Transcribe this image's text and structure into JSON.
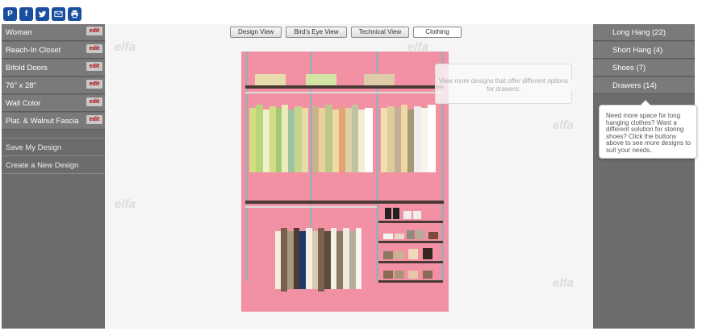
{
  "share": {
    "icons": [
      "pinterest-icon",
      "facebook-icon",
      "twitter-icon",
      "email-icon",
      "print-icon"
    ],
    "labels": [
      "P",
      "f"
    ]
  },
  "sidebar": {
    "items": [
      {
        "label": "Woman",
        "edit": "edit"
      },
      {
        "label": "Reach-In Closet",
        "edit": "edit"
      },
      {
        "label": "Bifold Doors",
        "edit": "edit"
      },
      {
        "label": "76\" x 28\"",
        "edit": "edit"
      },
      {
        "label": "Wall Color",
        "edit": "edit"
      },
      {
        "label": "Plat. & Walnut Fascia",
        "edit": "edit"
      }
    ],
    "actions": [
      {
        "label": "Save My Design"
      },
      {
        "label": "Create a New Design"
      }
    ]
  },
  "views": {
    "tabs": [
      {
        "label": "Design View"
      },
      {
        "label": "Bird's Eye View"
      },
      {
        "label": "Technical View"
      },
      {
        "label": "Clothing"
      }
    ],
    "active": "Clothing"
  },
  "watermark": "elfa",
  "tooltip_center": "View more designs that offer different options for drawers.",
  "options": {
    "items": [
      {
        "label": "Long Hang (22)"
      },
      {
        "label": "Short Hang (4)"
      },
      {
        "label": "Shoes (7)"
      },
      {
        "label": "Drawers (14)"
      }
    ]
  },
  "tooltip_right": "Need more space for long hanging clothes? Want a different solution for storing shoes? Click the buttons above to see more designs to suit your needs.",
  "colors": {
    "closet_wall": "#f291a3",
    "panel_gray": "#6c6c6c",
    "share_blue": "#1a4fa0",
    "edit_red": "#b00000"
  }
}
